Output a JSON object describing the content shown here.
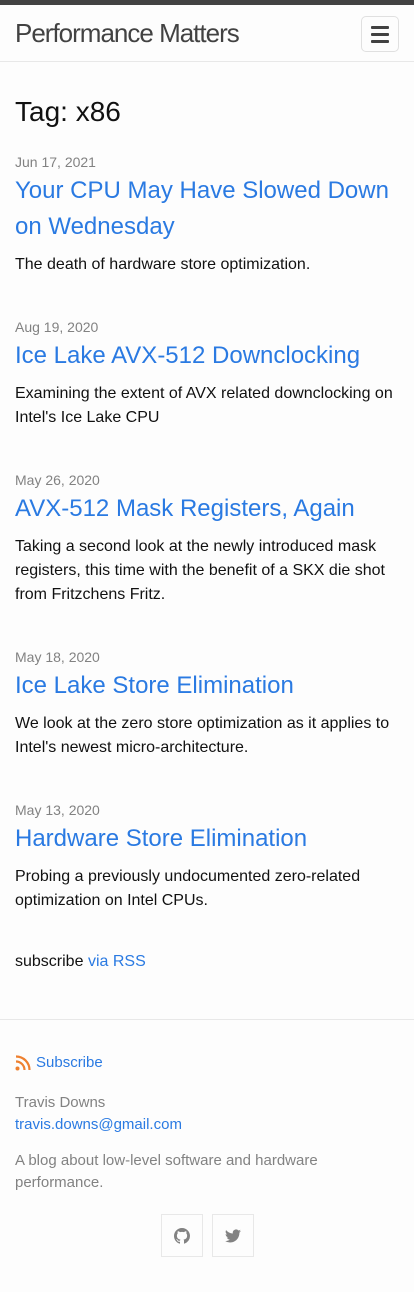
{
  "site": {
    "title": "Performance Matters"
  },
  "page": {
    "heading": "Tag: x86"
  },
  "posts": [
    {
      "date": "Jun 17, 2021",
      "title": "Your CPU May Have Slowed Down on Wednesday",
      "excerpt": "The death of hardware store optimization."
    },
    {
      "date": "Aug 19, 2020",
      "title": "Ice Lake AVX-512 Downclocking",
      "excerpt": "Examining the extent of AVX related downclocking on Intel's Ice Lake CPU"
    },
    {
      "date": "May 26, 2020",
      "title": "AVX-512 Mask Registers, Again",
      "excerpt": "Taking a second look at the newly introduced mask registers, this time with the benefit of a SKX die shot from Fritzchens Fritz."
    },
    {
      "date": "May 18, 2020",
      "title": "Ice Lake Store Elimination",
      "excerpt": "We look at the zero store optimization as it applies to Intel's newest micro-architecture."
    },
    {
      "date": "May 13, 2020",
      "title": "Hardware Store Elimination",
      "excerpt": "Probing a previously undocumented zero-related optimization on Intel CPUs."
    }
  ],
  "subscribe": {
    "prefix": "subscribe",
    "link_text": "via RSS"
  },
  "footer": {
    "feed_label": "Subscribe",
    "author": "Travis Downs",
    "email": "travis.downs@gmail.com",
    "description": "A blog about low-level software and hardware performance.",
    "icons": {
      "rss": "rss-icon",
      "github": "github-icon",
      "twitter": "twitter-icon"
    }
  },
  "colors": {
    "link": "#2a7ae2",
    "meta": "#828282",
    "topbar": "#424242"
  }
}
